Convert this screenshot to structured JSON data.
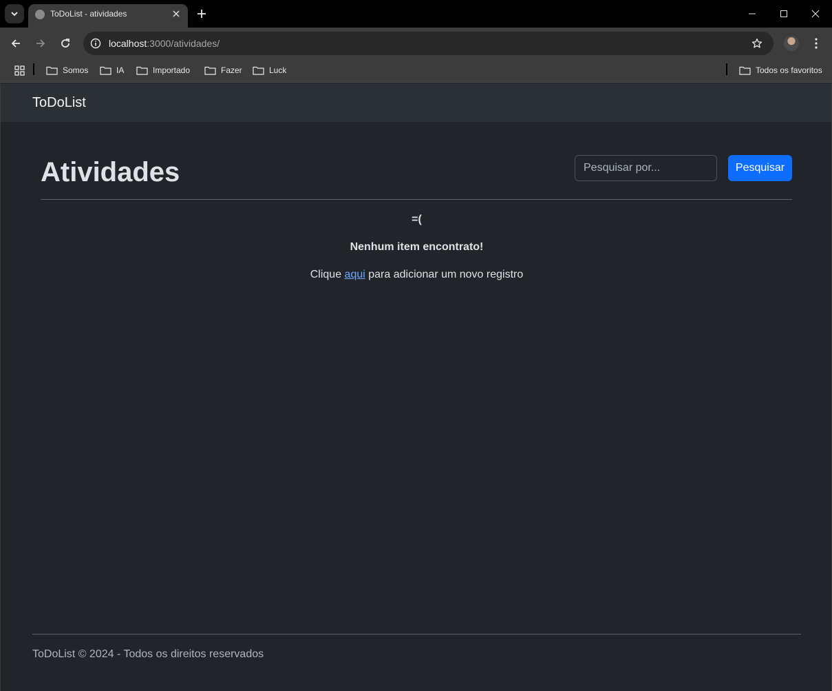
{
  "browser": {
    "tab_title": "ToDoList - atividades",
    "url_host": "localhost",
    "url_path": ":3000/atividades/",
    "bookmarks": [
      {
        "label": "Somos",
        "icon": "folder-icon"
      },
      {
        "label": "IA",
        "icon": "folder-icon"
      },
      {
        "label": "Importado",
        "icon": "folder-icon"
      },
      {
        "label": "Fazer",
        "icon": "folder-icon"
      },
      {
        "label": "Luck",
        "icon": "folder-icon"
      }
    ],
    "all_bookmarks_label": "Todos os favoritos"
  },
  "navbar": {
    "brand": "ToDoList"
  },
  "main": {
    "title": "Atividades",
    "search": {
      "placeholder": "Pesquisar por...",
      "value": "",
      "button_label": "Pesquisar"
    },
    "empty_state": {
      "face": "=(",
      "message": "Nenhum item encontrato!",
      "prefix": "Clique ",
      "link_text": "aqui",
      "suffix": " para adicionar um novo registro"
    }
  },
  "footer": {
    "text": "ToDoList © 2024 - Todos os direitos reservados"
  },
  "colors": {
    "page_bg": "#212529",
    "navbar_bg": "#2b3035",
    "primary": "#0d6efd",
    "link": "#6ea8fe"
  }
}
